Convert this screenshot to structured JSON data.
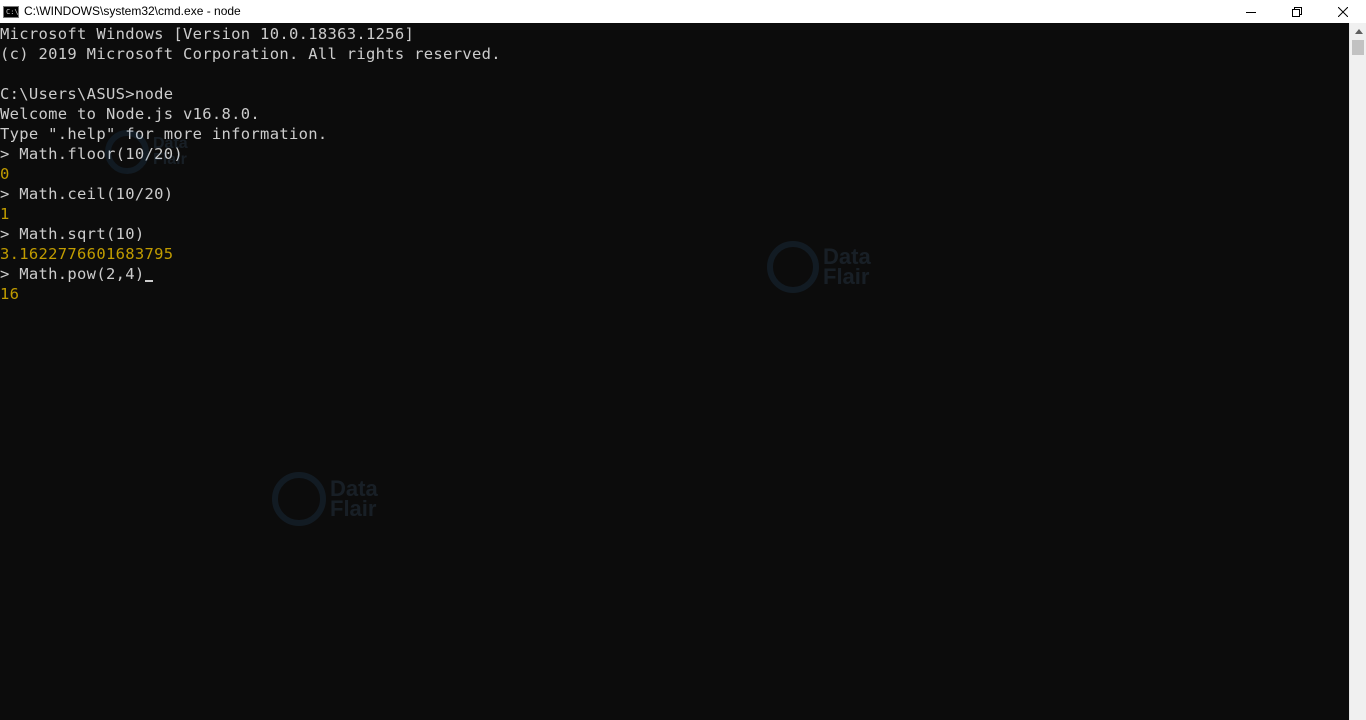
{
  "window": {
    "title": "C:\\WINDOWS\\system32\\cmd.exe - node",
    "icon": "cmd-icon",
    "controls": [
      "minimize-icon",
      "restore-icon",
      "close-icon"
    ]
  },
  "console": {
    "lines": [
      {
        "text": "Microsoft Windows [Version 10.0.18363.1256]",
        "kind": "output"
      },
      {
        "text": "(c) 2019 Microsoft Corporation. All rights reserved.",
        "kind": "output"
      },
      {
        "text": "",
        "kind": "output"
      },
      {
        "text": "C:\\Users\\ASUS>node",
        "kind": "output"
      },
      {
        "text": "Welcome to Node.js v16.8.0.",
        "kind": "output"
      },
      {
        "text": "Type \".help\" for more information.",
        "kind": "output"
      },
      {
        "text": "> Math.floor(10/20)",
        "kind": "input"
      },
      {
        "text": "0",
        "kind": "result"
      },
      {
        "text": "> Math.ceil(10/20)",
        "kind": "input"
      },
      {
        "text": "1",
        "kind": "result"
      },
      {
        "text": "> Math.sqrt(10)",
        "kind": "input"
      },
      {
        "text": "3.1622776601683795",
        "kind": "result"
      },
      {
        "text": "> Math.pow(2,4)",
        "kind": "input"
      },
      {
        "text": "16",
        "kind": "result"
      }
    ]
  },
  "watermark": {
    "line1": "Data",
    "line2": "Flair"
  },
  "colors": {
    "background": "#0c0c0c",
    "text": "#cccccc",
    "result": "#c19c00",
    "titlebar": "#ffffff"
  }
}
